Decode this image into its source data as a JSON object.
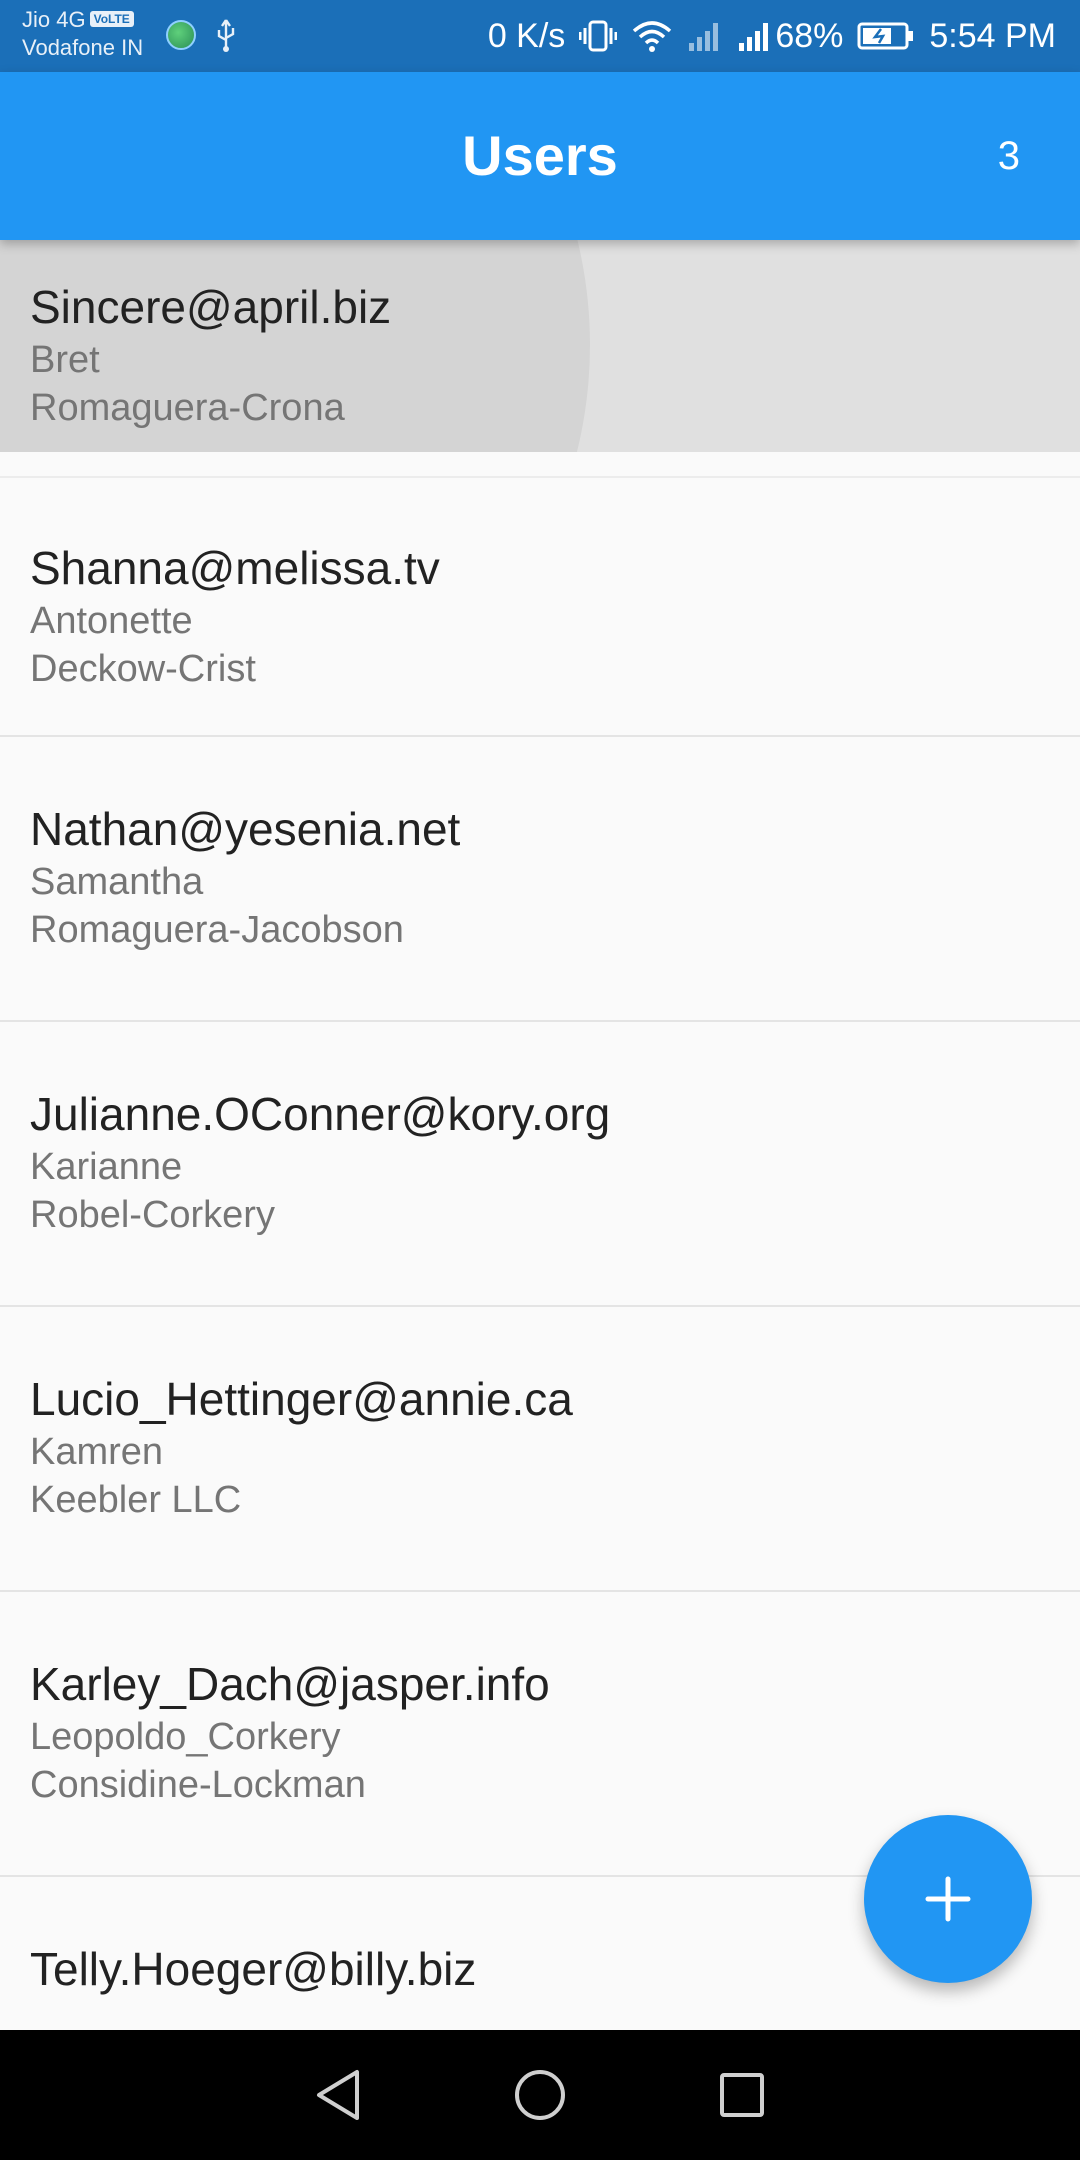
{
  "status_bar": {
    "carrier_1": "Jio 4G",
    "volte_badge": "VoLTE",
    "carrier_2": "Vodafone IN",
    "network_speed": "0 K/s",
    "battery_percent": "68%",
    "time": "5:54 PM"
  },
  "app_bar": {
    "title": "Users",
    "count": "3"
  },
  "users": [
    {
      "email": "Sincere@april.biz",
      "username": "Bret",
      "company": "Romaguera-Crona"
    },
    {
      "email": "Shanna@melissa.tv",
      "username": "Antonette",
      "company": "Deckow-Crist"
    },
    {
      "email": "Nathan@yesenia.net",
      "username": "Samantha",
      "company": "Romaguera-Jacobson"
    },
    {
      "email": "Julianne.OConner@kory.org",
      "username": "Karianne",
      "company": "Robel-Corkery"
    },
    {
      "email": "Lucio_Hettinger@annie.ca",
      "username": "Kamren",
      "company": "Keebler LLC"
    },
    {
      "email": "Karley_Dach@jasper.info",
      "username": "Leopoldo_Corkery",
      "company": "Considine-Lockman"
    },
    {
      "email": "Telly.Hoeger@billy.biz",
      "username": "",
      "company": ""
    }
  ],
  "colors": {
    "primary": "#2196f3",
    "status_bar": "#1b6fb8",
    "pressed_background": "#e0e0e0",
    "secondary_text": "#757575"
  },
  "icons": {
    "fab": "plus-icon",
    "nav_back": "back-triangle-icon",
    "nav_home": "home-circle-icon",
    "nav_recents": "recents-square-icon"
  }
}
